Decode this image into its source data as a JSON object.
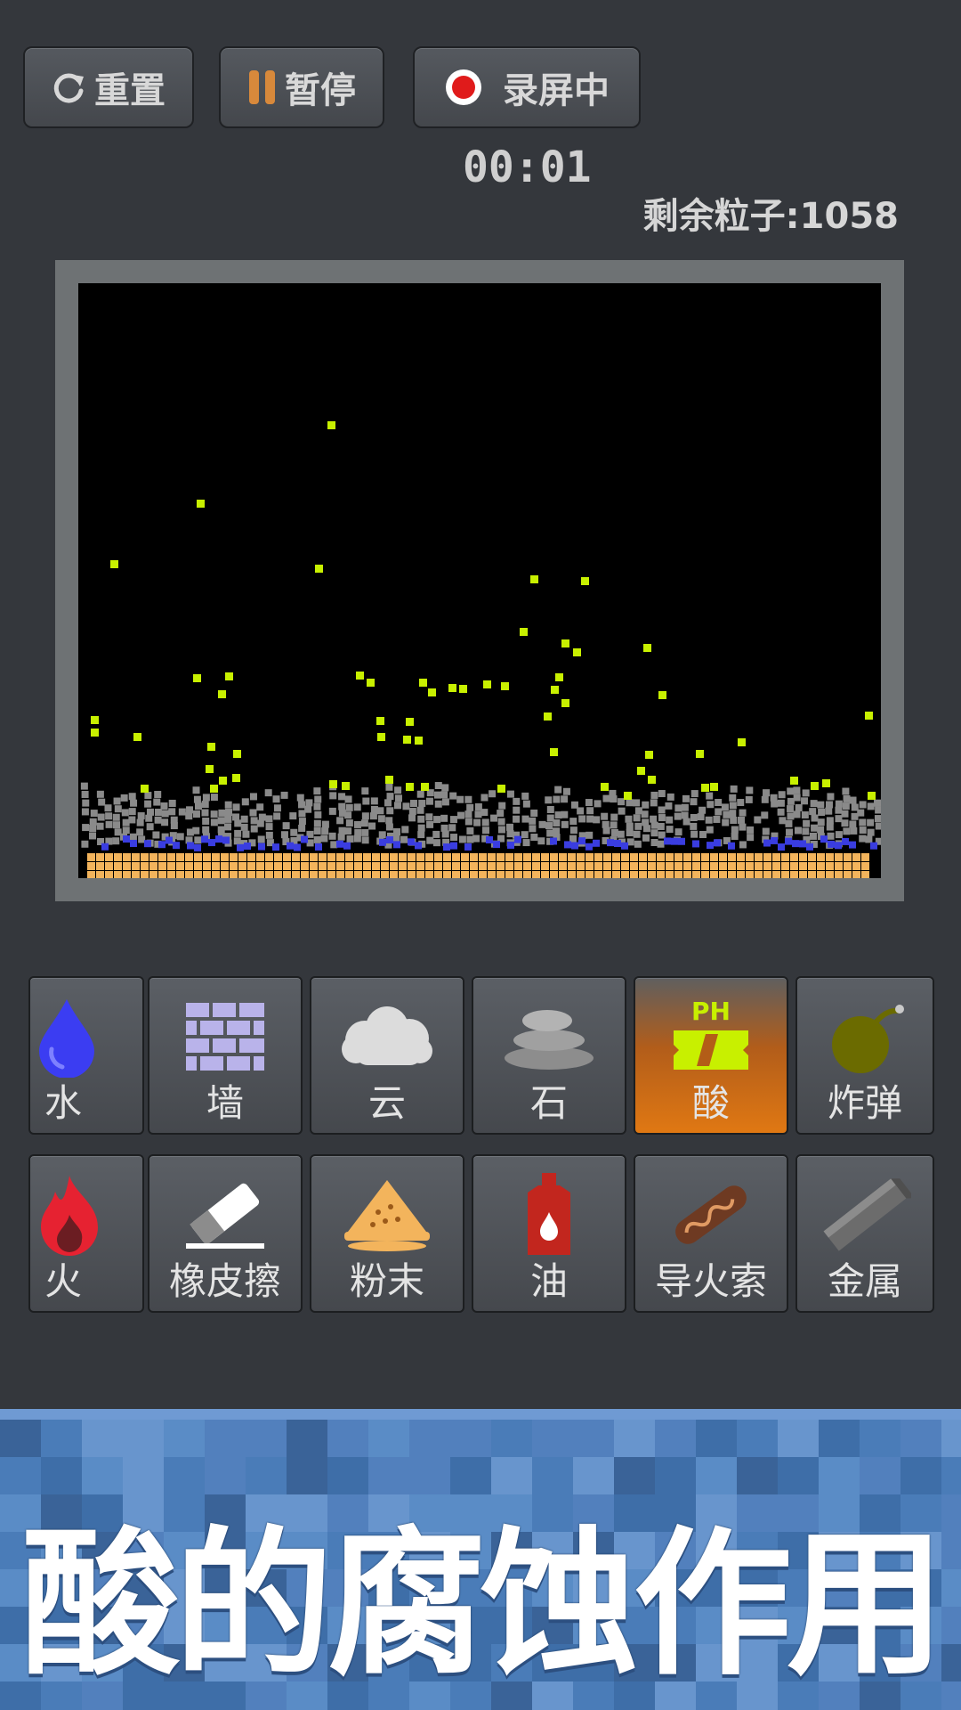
{
  "toolbar": {
    "reset_label": "重置",
    "pause_label": "暂停",
    "record_label": "录屏中",
    "timer": "00:01",
    "remaining_particles": "剩余粒子:1058"
  },
  "elements": [
    {
      "label": "水",
      "icon": "water-drop-icon"
    },
    {
      "label": "墙",
      "icon": "brick-wall-icon"
    },
    {
      "label": "云",
      "icon": "cloud-icon"
    },
    {
      "label": "石",
      "icon": "stone-icon"
    },
    {
      "label": "酸",
      "icon": "acid-ph-icon",
      "selected": true,
      "icon_text": "PH"
    },
    {
      "label": "炸弹",
      "icon": "bomb-icon"
    },
    {
      "label": "火",
      "icon": "fire-icon"
    },
    {
      "label": "橡皮擦",
      "icon": "eraser-icon"
    },
    {
      "label": "粉末",
      "icon": "powder-pile-icon"
    },
    {
      "label": "油",
      "icon": "oil-can-icon"
    },
    {
      "label": "导火索",
      "icon": "fuse-icon"
    },
    {
      "label": "金属",
      "icon": "metal-bar-icon"
    }
  ],
  "particle_colors": {
    "acid": "#c8f000",
    "stone": "#8a8a8a",
    "water": "#3a3de0",
    "powder": "#f3b45c",
    "canvas_bg": "#000000"
  },
  "banner": {
    "title": "酸的腐蚀作用",
    "background": "#4a7cb8"
  }
}
